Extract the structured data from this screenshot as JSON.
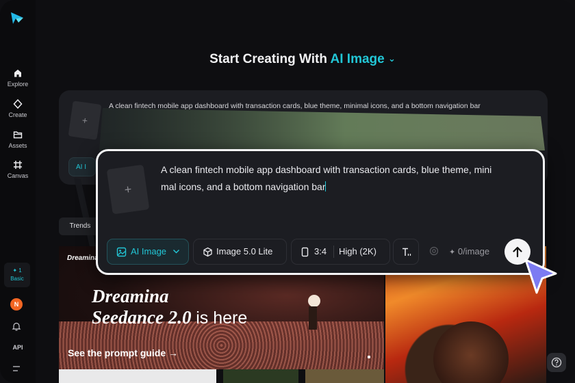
{
  "sidebar": {
    "items": [
      {
        "label": "Explore",
        "icon": "home-icon"
      },
      {
        "label": "Create",
        "icon": "sparkle-diamond-icon"
      },
      {
        "label": "Assets",
        "icon": "folder-icon"
      },
      {
        "label": "Canvas",
        "icon": "canvas-grid-icon"
      }
    ],
    "plan": {
      "credits": "✦ 1",
      "tier": "Basic"
    },
    "avatar_initial": "N",
    "api_label": "API"
  },
  "heading": {
    "prefix": "Start Creating With",
    "mode": "AI Image",
    "chevron": "⌄"
  },
  "background_prompt": {
    "text": "A clean fintech mobile app dashboard with transaction cards, blue theme, minimal icons, and a bottom navigation bar",
    "chip_label": "AI I"
  },
  "trends_tab": "Trends",
  "gallery": {
    "promo": {
      "brand": "Dreamina",
      "title_line1": "Dreamina",
      "title_line2": "Seedance 2.0",
      "title_tail": "is here",
      "guide_link": "See the prompt guide →"
    }
  },
  "prompt_card": {
    "text_line1": "A clean fintech mobile app dashboard with transaction cards, blue theme, mini",
    "text_line2": "mal icons, and a bottom navigation bar",
    "upload_symbol": "+",
    "tools": {
      "mode": "AI Image",
      "model": "Image 5.0 Lite",
      "ratio": "3:4",
      "quality": "High (2K)",
      "credits": "0/image"
    }
  },
  "colors": {
    "accent": "#22c6d6",
    "background": "#0e0e11",
    "card": "#1c1d22",
    "cursor": "#7c7bf2"
  }
}
